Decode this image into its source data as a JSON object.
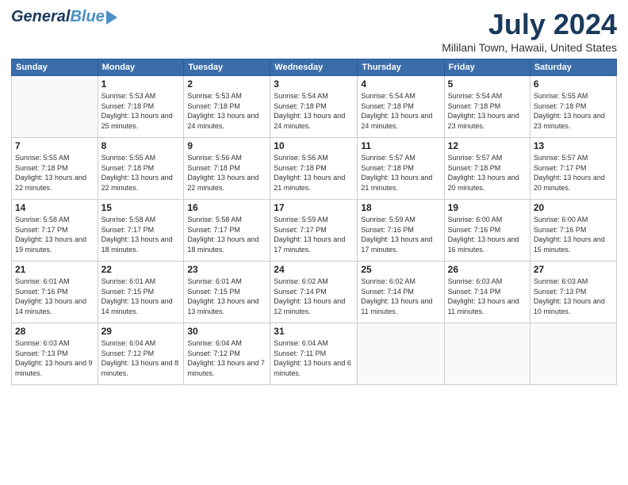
{
  "header": {
    "logo_general": "General",
    "logo_blue": "Blue",
    "month_title": "July 2024",
    "location": "Mililani Town, Hawaii, United States"
  },
  "weekdays": [
    "Sunday",
    "Monday",
    "Tuesday",
    "Wednesday",
    "Thursday",
    "Friday",
    "Saturday"
  ],
  "weeks": [
    [
      {
        "day": "",
        "sunrise": "",
        "sunset": "",
        "daylight": ""
      },
      {
        "day": "1",
        "sunrise": "Sunrise: 5:53 AM",
        "sunset": "Sunset: 7:18 PM",
        "daylight": "Daylight: 13 hours and 25 minutes."
      },
      {
        "day": "2",
        "sunrise": "Sunrise: 5:53 AM",
        "sunset": "Sunset: 7:18 PM",
        "daylight": "Daylight: 13 hours and 24 minutes."
      },
      {
        "day": "3",
        "sunrise": "Sunrise: 5:54 AM",
        "sunset": "Sunset: 7:18 PM",
        "daylight": "Daylight: 13 hours and 24 minutes."
      },
      {
        "day": "4",
        "sunrise": "Sunrise: 5:54 AM",
        "sunset": "Sunset: 7:18 PM",
        "daylight": "Daylight: 13 hours and 24 minutes."
      },
      {
        "day": "5",
        "sunrise": "Sunrise: 5:54 AM",
        "sunset": "Sunset: 7:18 PM",
        "daylight": "Daylight: 13 hours and 23 minutes."
      },
      {
        "day": "6",
        "sunrise": "Sunrise: 5:55 AM",
        "sunset": "Sunset: 7:18 PM",
        "daylight": "Daylight: 13 hours and 23 minutes."
      }
    ],
    [
      {
        "day": "7",
        "sunrise": "Sunrise: 5:55 AM",
        "sunset": "Sunset: 7:18 PM",
        "daylight": "Daylight: 13 hours and 22 minutes."
      },
      {
        "day": "8",
        "sunrise": "Sunrise: 5:55 AM",
        "sunset": "Sunset: 7:18 PM",
        "daylight": "Daylight: 13 hours and 22 minutes."
      },
      {
        "day": "9",
        "sunrise": "Sunrise: 5:56 AM",
        "sunset": "Sunset: 7:18 PM",
        "daylight": "Daylight: 13 hours and 22 minutes."
      },
      {
        "day": "10",
        "sunrise": "Sunrise: 5:56 AM",
        "sunset": "Sunset: 7:18 PM",
        "daylight": "Daylight: 13 hours and 21 minutes."
      },
      {
        "day": "11",
        "sunrise": "Sunrise: 5:57 AM",
        "sunset": "Sunset: 7:18 PM",
        "daylight": "Daylight: 13 hours and 21 minutes."
      },
      {
        "day": "12",
        "sunrise": "Sunrise: 5:57 AM",
        "sunset": "Sunset: 7:18 PM",
        "daylight": "Daylight: 13 hours and 20 minutes."
      },
      {
        "day": "13",
        "sunrise": "Sunrise: 5:57 AM",
        "sunset": "Sunset: 7:17 PM",
        "daylight": "Daylight: 13 hours and 20 minutes."
      }
    ],
    [
      {
        "day": "14",
        "sunrise": "Sunrise: 5:58 AM",
        "sunset": "Sunset: 7:17 PM",
        "daylight": "Daylight: 13 hours and 19 minutes."
      },
      {
        "day": "15",
        "sunrise": "Sunrise: 5:58 AM",
        "sunset": "Sunset: 7:17 PM",
        "daylight": "Daylight: 13 hours and 18 minutes."
      },
      {
        "day": "16",
        "sunrise": "Sunrise: 5:58 AM",
        "sunset": "Sunset: 7:17 PM",
        "daylight": "Daylight: 13 hours and 18 minutes."
      },
      {
        "day": "17",
        "sunrise": "Sunrise: 5:59 AM",
        "sunset": "Sunset: 7:17 PM",
        "daylight": "Daylight: 13 hours and 17 minutes."
      },
      {
        "day": "18",
        "sunrise": "Sunrise: 5:59 AM",
        "sunset": "Sunset: 7:16 PM",
        "daylight": "Daylight: 13 hours and 17 minutes."
      },
      {
        "day": "19",
        "sunrise": "Sunrise: 6:00 AM",
        "sunset": "Sunset: 7:16 PM",
        "daylight": "Daylight: 13 hours and 16 minutes."
      },
      {
        "day": "20",
        "sunrise": "Sunrise: 6:00 AM",
        "sunset": "Sunset: 7:16 PM",
        "daylight": "Daylight: 13 hours and 15 minutes."
      }
    ],
    [
      {
        "day": "21",
        "sunrise": "Sunrise: 6:01 AM",
        "sunset": "Sunset: 7:16 PM",
        "daylight": "Daylight: 13 hours and 14 minutes."
      },
      {
        "day": "22",
        "sunrise": "Sunrise: 6:01 AM",
        "sunset": "Sunset: 7:15 PM",
        "daylight": "Daylight: 13 hours and 14 minutes."
      },
      {
        "day": "23",
        "sunrise": "Sunrise: 6:01 AM",
        "sunset": "Sunset: 7:15 PM",
        "daylight": "Daylight: 13 hours and 13 minutes."
      },
      {
        "day": "24",
        "sunrise": "Sunrise: 6:02 AM",
        "sunset": "Sunset: 7:14 PM",
        "daylight": "Daylight: 13 hours and 12 minutes."
      },
      {
        "day": "25",
        "sunrise": "Sunrise: 6:02 AM",
        "sunset": "Sunset: 7:14 PM",
        "daylight": "Daylight: 13 hours and 11 minutes."
      },
      {
        "day": "26",
        "sunrise": "Sunrise: 6:03 AM",
        "sunset": "Sunset: 7:14 PM",
        "daylight": "Daylight: 13 hours and 11 minutes."
      },
      {
        "day": "27",
        "sunrise": "Sunrise: 6:03 AM",
        "sunset": "Sunset: 7:13 PM",
        "daylight": "Daylight: 13 hours and 10 minutes."
      }
    ],
    [
      {
        "day": "28",
        "sunrise": "Sunrise: 6:03 AM",
        "sunset": "Sunset: 7:13 PM",
        "daylight": "Daylight: 13 hours and 9 minutes."
      },
      {
        "day": "29",
        "sunrise": "Sunrise: 6:04 AM",
        "sunset": "Sunset: 7:12 PM",
        "daylight": "Daylight: 13 hours and 8 minutes."
      },
      {
        "day": "30",
        "sunrise": "Sunrise: 6:04 AM",
        "sunset": "Sunset: 7:12 PM",
        "daylight": "Daylight: 13 hours and 7 minutes."
      },
      {
        "day": "31",
        "sunrise": "Sunrise: 6:04 AM",
        "sunset": "Sunset: 7:11 PM",
        "daylight": "Daylight: 13 hours and 6 minutes."
      },
      {
        "day": "",
        "sunrise": "",
        "sunset": "",
        "daylight": ""
      },
      {
        "day": "",
        "sunrise": "",
        "sunset": "",
        "daylight": ""
      },
      {
        "day": "",
        "sunrise": "",
        "sunset": "",
        "daylight": ""
      }
    ]
  ]
}
